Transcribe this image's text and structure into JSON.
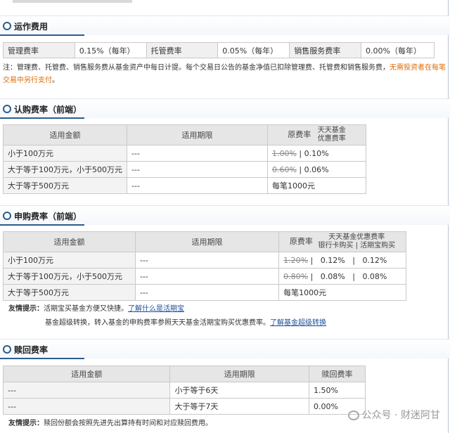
{
  "ops_fee": {
    "section_title": "运作费用",
    "cells": [
      "管理费率",
      "0.15%（每年）",
      "托管费率",
      "0.05%（每年）",
      "销售服务费率",
      "0.00%（每年）"
    ],
    "note_a": "注：管理费、托管费、销售服务费从基金资产中每日计提。每个交易日公告的基金净值已扣除管理费、托管费和销售服务费，",
    "note_orange": "无需投资者在每笔交易中另行支付",
    "note_end": "。"
  },
  "subscribe": {
    "section_title": "认购费率（前端）",
    "headers": {
      "amount": "适用金额",
      "period": "适用期限",
      "orig": "原费率",
      "disc_top": "天天基金",
      "disc_bottom": "优惠费率"
    },
    "rows": [
      {
        "amount": "小于100万元",
        "period": "---",
        "orig": "1.00%",
        "sep": "|",
        "disc": "0.10%"
      },
      {
        "amount": "大于等于100万元，小于500万元",
        "period": "---",
        "orig": "0.60%",
        "sep": "|",
        "disc": "0.06%"
      },
      {
        "amount": "大于等于500万元",
        "period": "---",
        "flat": "每笔1000元"
      }
    ]
  },
  "purchase": {
    "section_title": "申购费率（前端）",
    "headers": {
      "amount": "适用金额",
      "period": "适用期限",
      "orig": "原费率",
      "disc_title": "天天基金优惠费率",
      "bank": "银行卡购买",
      "huoqi": "活期宝购买"
    },
    "rows": [
      {
        "amount": "小于100万元",
        "period": "---",
        "orig": "1.20%",
        "bank": "0.12%",
        "huoqi": "0.12%"
      },
      {
        "amount": "大于等于100万元，小于500万元",
        "period": "---",
        "orig": "0.80%",
        "bank": "0.08%",
        "huoqi": "0.08%"
      },
      {
        "amount": "大于等于500万元",
        "period": "---",
        "flat": "每笔1000元"
      }
    ],
    "sep": "|",
    "tip_label": "友情提示：",
    "tip_1": "活期宝买基金方便又快捷。",
    "tip_1_link": "了解什么是活期宝",
    "tip_2": "基金超级转换，转入基金的申购费率参照天天基金活期宝购买优惠费率。",
    "tip_2_link": "了解基金超级转换"
  },
  "redeem": {
    "section_title": "赎回费率",
    "headers": {
      "amount": "适用金额",
      "period": "适用期限",
      "rate": "赎回费率"
    },
    "rows": [
      {
        "amount": "---",
        "period": "小于等于6天",
        "rate": "1.50%"
      },
      {
        "amount": "---",
        "period": "大于等于7天",
        "rate": "0.00%"
      }
    ],
    "tip_label": "友情提示：",
    "tip": "赎回份额会按照先进先出算持有时间和对应赎回费用。"
  },
  "watermark": "公众号 · 财迷阿甘"
}
